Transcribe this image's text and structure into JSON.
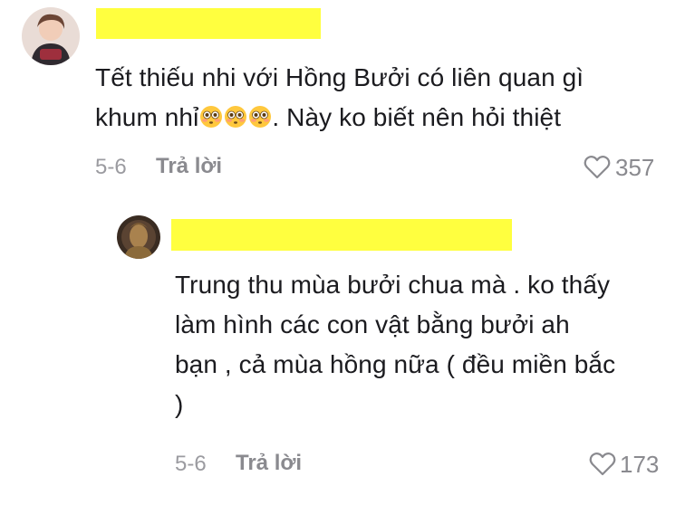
{
  "comments": [
    {
      "author_redacted": true,
      "text_line1": "Tết thiếu nhi với Hồng Bưởi có liên quan gì",
      "text_line2_start": "khum nhỉ",
      "text_line2_end": ". Này ko biết nên hỏi thiệt",
      "emoji": "flushed-face",
      "emoji_count": 3,
      "date": "5-6",
      "reply_label": "Trả lời",
      "like_count": "357"
    },
    {
      "author_redacted": true,
      "text_lines": [
        "Trung thu mùa bưởi chua mà . ko thấy",
        "làm hình các con vật bằng bưởi ah",
        "bạn , cả mùa hồng nữa ( đều miền bắc",
        ")"
      ],
      "date": "5-6",
      "reply_label": "Trả lời",
      "like_count": "173"
    }
  ],
  "colors": {
    "redaction": "#ffff3f",
    "text": "#1b1b1f",
    "meta": "#8a8a8f"
  },
  "icons": {
    "like": "heart-outline-icon",
    "emoji": "flushed-face-emoji"
  }
}
